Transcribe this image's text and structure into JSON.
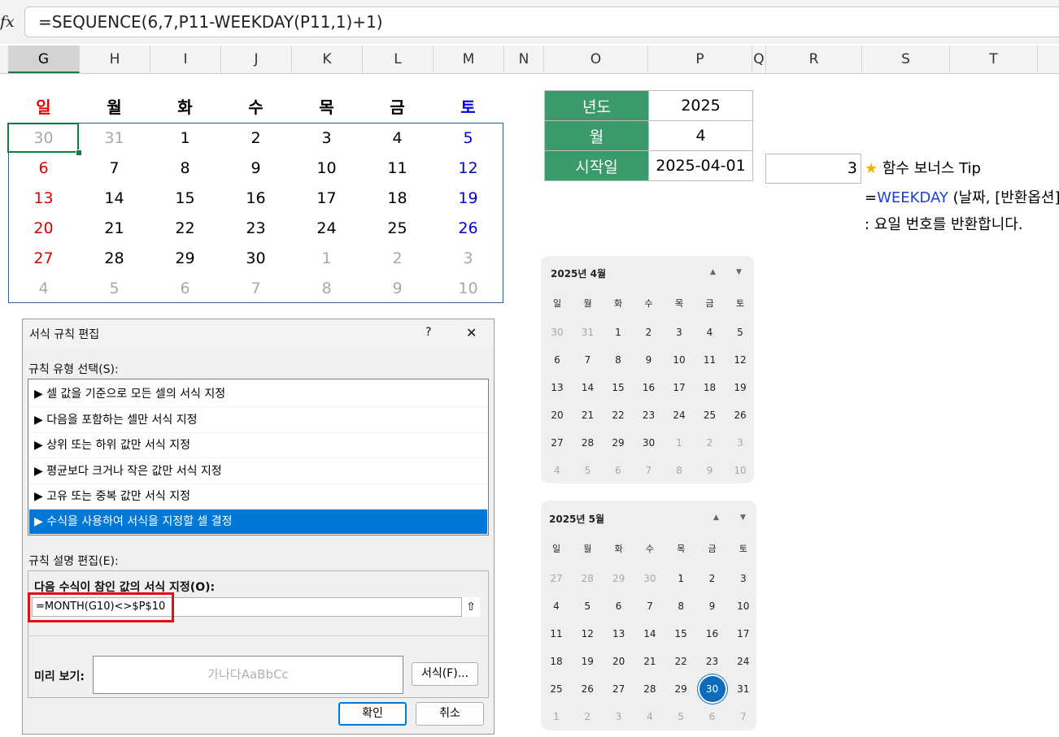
{
  "formula_bar": {
    "fx_label": "fx",
    "formula": "=SEQUENCE(6,7,P11-WEEKDAY(P11,1)+1)"
  },
  "columns": [
    "G",
    "H",
    "I",
    "J",
    "K",
    "L",
    "M",
    "N",
    "O",
    "P",
    "Q",
    "R",
    "S",
    "T"
  ],
  "calendar": {
    "weekdays": [
      "일",
      "월",
      "화",
      "수",
      "목",
      "금",
      "토"
    ],
    "rows": [
      [
        "30",
        "31",
        "1",
        "2",
        "3",
        "4",
        "5"
      ],
      [
        "6",
        "7",
        "8",
        "9",
        "10",
        "11",
        "12"
      ],
      [
        "13",
        "14",
        "15",
        "16",
        "17",
        "18",
        "19"
      ],
      [
        "20",
        "21",
        "22",
        "23",
        "24",
        "25",
        "26"
      ],
      [
        "27",
        "28",
        "29",
        "30",
        "1",
        "2",
        "3"
      ],
      [
        "4",
        "5",
        "6",
        "7",
        "8",
        "9",
        "10"
      ]
    ]
  },
  "info_table": {
    "year_label": "년도",
    "year_value": "2025",
    "month_label": "월",
    "month_value": "4",
    "start_label": "시작일",
    "start_value": "2025-04-01"
  },
  "r11_value": "3",
  "tip": {
    "star": "★",
    "title": "함수 보너스 Tip",
    "syntax_prefix": "=",
    "syntax_func": "WEEKDAY",
    "syntax_args": " (날짜, [반환옵션])",
    "description": ": 요일 번호를 반환합니다."
  },
  "mini_april": {
    "title": "2025년 4월",
    "weekdays": [
      "일",
      "월",
      "화",
      "수",
      "목",
      "금",
      "토"
    ],
    "rows": [
      [
        "30",
        "31",
        "1",
        "2",
        "3",
        "4",
        "5"
      ],
      [
        "6",
        "7",
        "8",
        "9",
        "10",
        "11",
        "12"
      ],
      [
        "13",
        "14",
        "15",
        "16",
        "17",
        "18",
        "19"
      ],
      [
        "20",
        "21",
        "22",
        "23",
        "24",
        "25",
        "26"
      ],
      [
        "27",
        "28",
        "29",
        "30",
        "1",
        "2",
        "3"
      ],
      [
        "4",
        "5",
        "6",
        "7",
        "8",
        "9",
        "10"
      ]
    ]
  },
  "mini_may": {
    "title": "2025년 5월",
    "weekdays": [
      "일",
      "월",
      "화",
      "수",
      "목",
      "금",
      "토"
    ],
    "rows": [
      [
        "27",
        "28",
        "29",
        "30",
        "1",
        "2",
        "3"
      ],
      [
        "4",
        "5",
        "6",
        "7",
        "8",
        "9",
        "10"
      ],
      [
        "11",
        "12",
        "13",
        "14",
        "15",
        "16",
        "17"
      ],
      [
        "18",
        "19",
        "20",
        "21",
        "22",
        "23",
        "24"
      ],
      [
        "25",
        "26",
        "27",
        "28",
        "29",
        "30",
        "31"
      ],
      [
        "1",
        "2",
        "3",
        "4",
        "5",
        "6",
        "7"
      ]
    ],
    "today": "30"
  },
  "dialog": {
    "title": "서식 규칙 편집",
    "help": "?",
    "close": "✕",
    "rule_type_label": "규칙 유형 선택(S):",
    "rule_types": [
      "▶ 셀 값을 기준으로 모든 셀의 서식 지정",
      "▶ 다음을 포함하는 셀만 서식 지정",
      "▶ 상위 또는 하위 값만 서식 지정",
      "▶ 평균보다 크거나 작은 값만 서식 지정",
      "▶ 고유 또는 중복 값만 서식 지정",
      "▶ 수식을 사용하여 서식을 지정할 셀 결정"
    ],
    "desc_label": "규칙 설명 편집(E):",
    "formula_label": "다음 수식이 참인 값의 서식 지정(O):",
    "formula_value": "=MONTH(G10)<>$P$10",
    "preview_label": "미리 보기:",
    "preview_text": "가나다AaBbCc",
    "format_button": "서식(F)...",
    "ok_button": "확인",
    "cancel_button": "취소"
  },
  "colors": {
    "sunday": "#e00000",
    "saturday": "#0000e0",
    "dim": "#a8a8a8",
    "header_green": "#3a9a6a",
    "selection_blue": "#0078d7"
  }
}
